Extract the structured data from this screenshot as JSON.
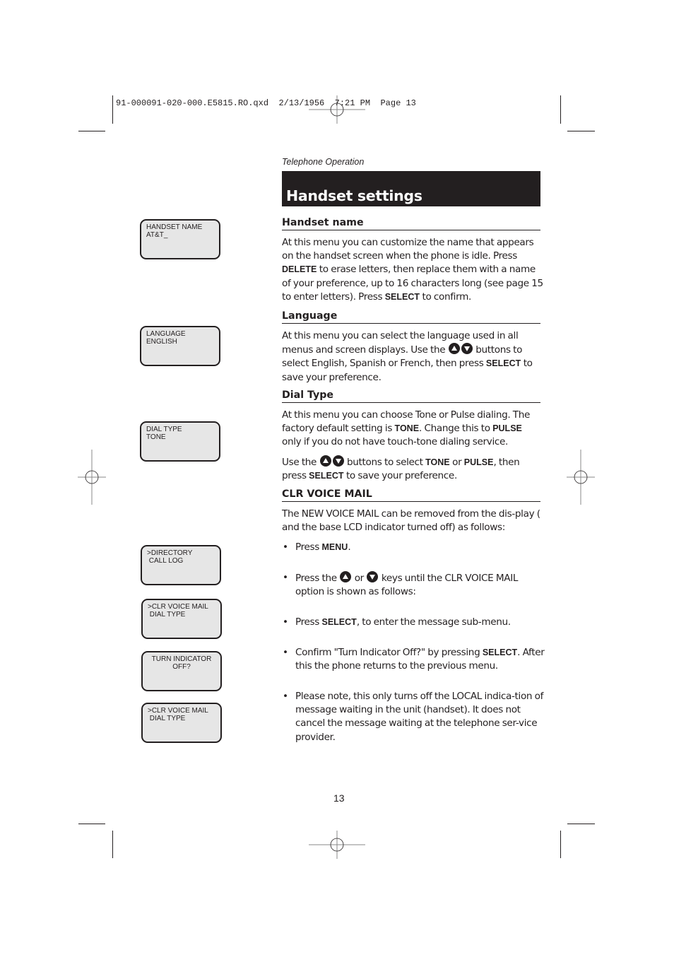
{
  "slug": "91-000091-020-000.E5815.RO.qxd  2/13/1956  7:21 PM  Page 13",
  "section_label": "Telephone Operation",
  "title": "Handset settings",
  "lcd_screens": [
    {
      "line1": "HANDSET NAME",
      "line2": "AT&T_"
    },
    {
      "line1": "LANGUAGE",
      "line2": "ENGLISH"
    },
    {
      "line1": "DIAL TYPE",
      "line2": "TONE"
    },
    {
      "line1": ">DIRECTORY",
      "line2": " CALL LOG"
    },
    {
      "line1": ">CLR VOICE MAIL",
      "line2": " DIAL TYPE"
    },
    {
      "line1": "TURN INDICATOR",
      "line2": "OFF?"
    },
    {
      "line1": ">CLR VOICE MAIL",
      "line2": " DIAL TYPE"
    }
  ],
  "sections": {
    "handset_name": {
      "heading": "Handset name",
      "p1_a": "At this menu you can customize the name that appears on the handset screen when the phone is idle. Press ",
      "key_delete": "DELETE",
      "p1_b": " to erase letters, then replace them with a name of your preference, up to 16 characters long (see page 15 to enter letters). Press ",
      "key_select": "SELECT",
      "p1_c": " to confirm."
    },
    "language": {
      "heading": "Language",
      "p1_a": "At this menu you can select the language used in all menus and screen displays. Use the ",
      "p1_b": " buttons to select English, Spanish or French, then press ",
      "key_select": "SELECT",
      "p1_c": " to save your preference."
    },
    "dial_type": {
      "heading": "Dial Type",
      "p1_a": "At this menu you can choose Tone or Pulse dialing. The factory default setting is ",
      "key_tone": "TONE",
      "p1_b": ". Change this to ",
      "key_pulse": "PULSE",
      "p1_c": " only if you do not have touch-tone dialing service.",
      "p2_a": "Use the ",
      "p2_b": " buttons to select ",
      "p2_c": " or ",
      "p2_d": ", then press ",
      "key_select": "SELECT",
      "p2_e": " to save your preference."
    },
    "clr_voice_mail": {
      "heading": "CLR VOICE MAIL",
      "intro": "The NEW VOICE MAIL can be removed from the dis-play ( and the base LCD indicator turned off) as follows:",
      "bullets": {
        "b1_a": "Press ",
        "b1_key": "MENU",
        "b1_b": ".",
        "b2_a": "Press the ",
        "b2_b": " or ",
        "b2_c": " keys until the CLR VOICE MAIL option is shown as follows:",
        "b3_a": "Press ",
        "b3_key": "SELECT",
        "b3_b": ", to enter the message sub-menu.",
        "b4_a": "Confirm \"Turn Indicator Off?\" by pressing ",
        "b4_key": "SELECT",
        "b4_b": ". After this the phone returns to the previous menu.",
        "b5": "Please note,  this only turns off the LOCAL indica-tion of message waiting in the unit (handset).  It does not cancel the message waiting at the telephone ser-vice provider."
      }
    }
  },
  "icons": {
    "up": "up-arrow-button-icon",
    "down": "down-arrow-button-icon"
  },
  "bullet_char": "•",
  "page_number": "13",
  "colors": {
    "ink": "#231f20",
    "lcd_bg": "#e6e6e6",
    "paper": "#ffffff"
  }
}
